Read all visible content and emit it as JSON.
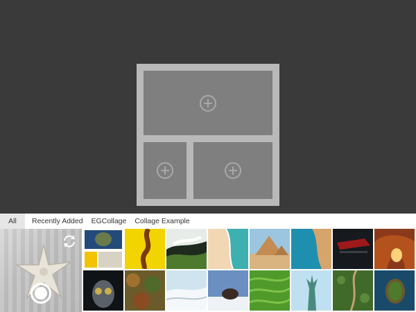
{
  "tabs": {
    "all": "All",
    "recently_added": "Recently Added",
    "egcollage": "EGCollage",
    "collage_example": "Collage Example"
  },
  "icons": {
    "add": "plus-circle-icon",
    "switch_camera": "switch-camera-icon",
    "shutter": "shutter-button-icon"
  },
  "colors": {
    "canvas_bg": "#3a3a3a",
    "frame": "#b9b9b9",
    "slot": "#7f7f7f"
  },
  "photos": [
    "collage-preview",
    "yellow-abstract",
    "glacier-landscape",
    "beach-aerial",
    "pyramids",
    "coast-aerial",
    "red-car",
    "canyon-arch",
    "owl",
    "autumn-forest",
    "snow-dunes",
    "eagle-in-snow",
    "green-field",
    "statue-of-liberty",
    "forest-road",
    "island-aerial"
  ]
}
